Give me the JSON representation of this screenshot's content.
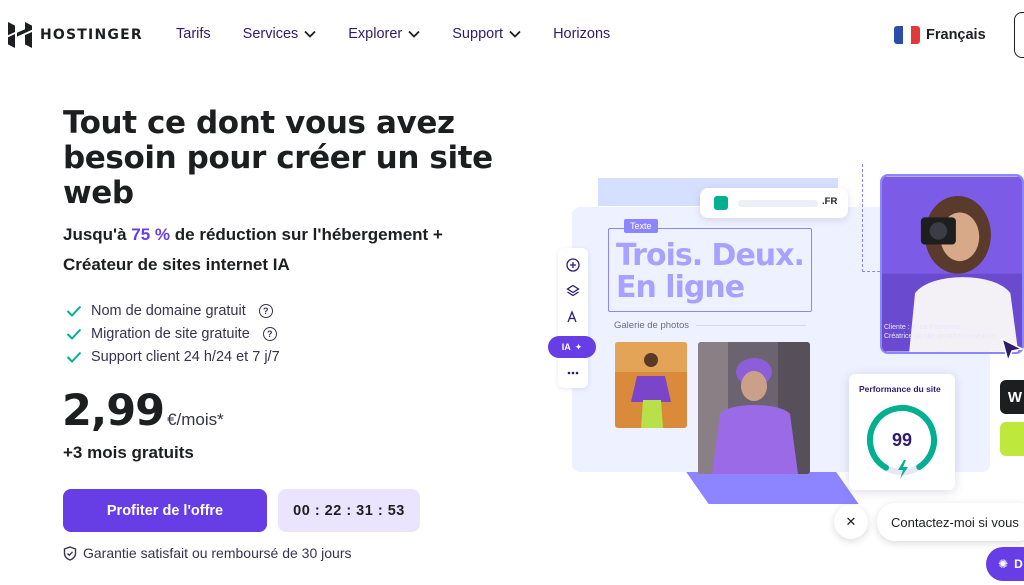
{
  "brand": {
    "name": "HOSTINGER"
  },
  "nav": {
    "items": [
      {
        "label": "Tarifs",
        "dropdown": false
      },
      {
        "label": "Services",
        "dropdown": true
      },
      {
        "label": "Explorer",
        "dropdown": true
      },
      {
        "label": "Support",
        "dropdown": true
      },
      {
        "label": "Horizons",
        "dropdown": false
      }
    ],
    "language": "Français"
  },
  "hero": {
    "title": "Tout ce dont vous avez besoin pour créer un site web",
    "subtitle_prefix": "Jusqu'à ",
    "subtitle_accent": "75 %",
    "subtitle_suffix": " de réduction sur l'hébergement + Créateur de sites internet IA",
    "features": [
      {
        "label": "Nom de domaine gratuit",
        "help": true
      },
      {
        "label": "Migration de site gratuite",
        "help": true
      },
      {
        "label": "Support client 24 h/24 et 7 j/7",
        "help": false
      }
    ],
    "price": "2,99",
    "price_unit": "€/mois*",
    "bonus": "+3 mois gratuits",
    "cta_label": "Profiter de l'offre",
    "timer": "00 : 22 : 31 : 53",
    "guarantee": "Garantie satisfait ou remboursé de 30 jours"
  },
  "illustration": {
    "url_ext": ".FR",
    "text_tag": "Texte",
    "big_text_line1": "Trois. Deux.",
    "big_text_line2": "En ligne",
    "gallery_label": "Galerie de photos",
    "ia_label": "IA",
    "photo_caption_line1": "Cliente : Anna Françoise",
    "photo_caption_line2": "Créatrice du site annafrançoise.com",
    "perf_title": "Performance du site",
    "perf_score": "99",
    "perf_fraction": 0.99
  },
  "chat": {
    "close_label": "✕",
    "bubble_text": "Contactez-moi si vous",
    "button_label": "D"
  },
  "colors": {
    "accent": "#673de6",
    "accent_light": "#ebe4ff",
    "check": "#00b090",
    "lavender": "#8c85ff"
  }
}
